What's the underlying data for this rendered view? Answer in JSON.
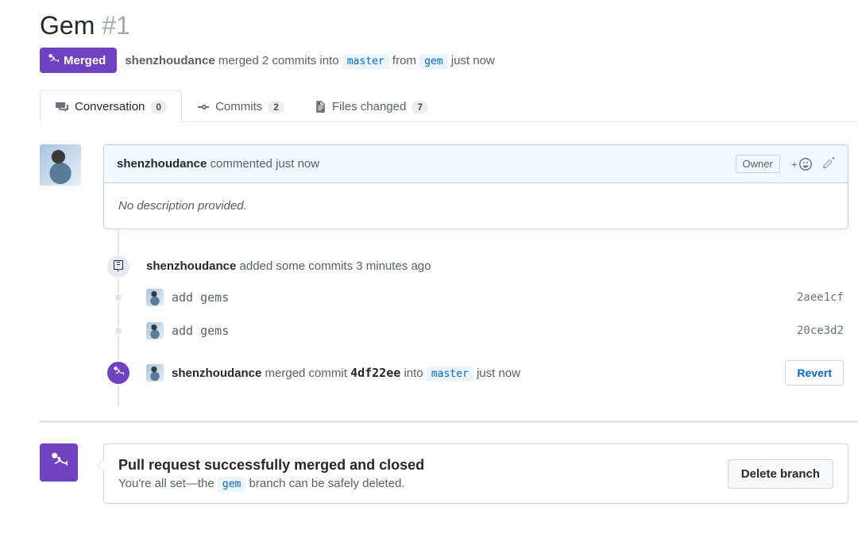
{
  "title": {
    "text": "Gem",
    "number": "#1"
  },
  "state": {
    "label": "Merged"
  },
  "meta": {
    "author": "shenzhoudance",
    "action": " merged 2 commits into ",
    "base_branch": "master",
    "mid": " from ",
    "head_branch": "gem",
    "time": " just now"
  },
  "tabs": {
    "conversation": {
      "label": "Conversation",
      "count": "0"
    },
    "commits": {
      "label": "Commits",
      "count": "2"
    },
    "files": {
      "label": "Files changed",
      "count": "7"
    }
  },
  "comment": {
    "author": "shenzhoudance",
    "action": " commented just now",
    "owner_label": "Owner",
    "body": "No description provided."
  },
  "push_event": {
    "author": "shenzhoudance",
    "action": " added some commits 3 minutes ago"
  },
  "commits": [
    {
      "msg": "add gems",
      "sha": "2aee1cf"
    },
    {
      "msg": "add gems",
      "sha": "20ce3d2"
    }
  ],
  "merge_event": {
    "author": "shenzhoudance",
    "action_pre": " merged commit ",
    "commit": "4df22ee",
    "action_mid": " into ",
    "branch": "master",
    "time": " just now",
    "revert_label": "Revert"
  },
  "merged_banner": {
    "title": "Pull request successfully merged and closed",
    "sub_pre": "You're all set—the ",
    "branch": "gem",
    "sub_post": " branch can be safely deleted.",
    "delete_label": "Delete branch"
  }
}
